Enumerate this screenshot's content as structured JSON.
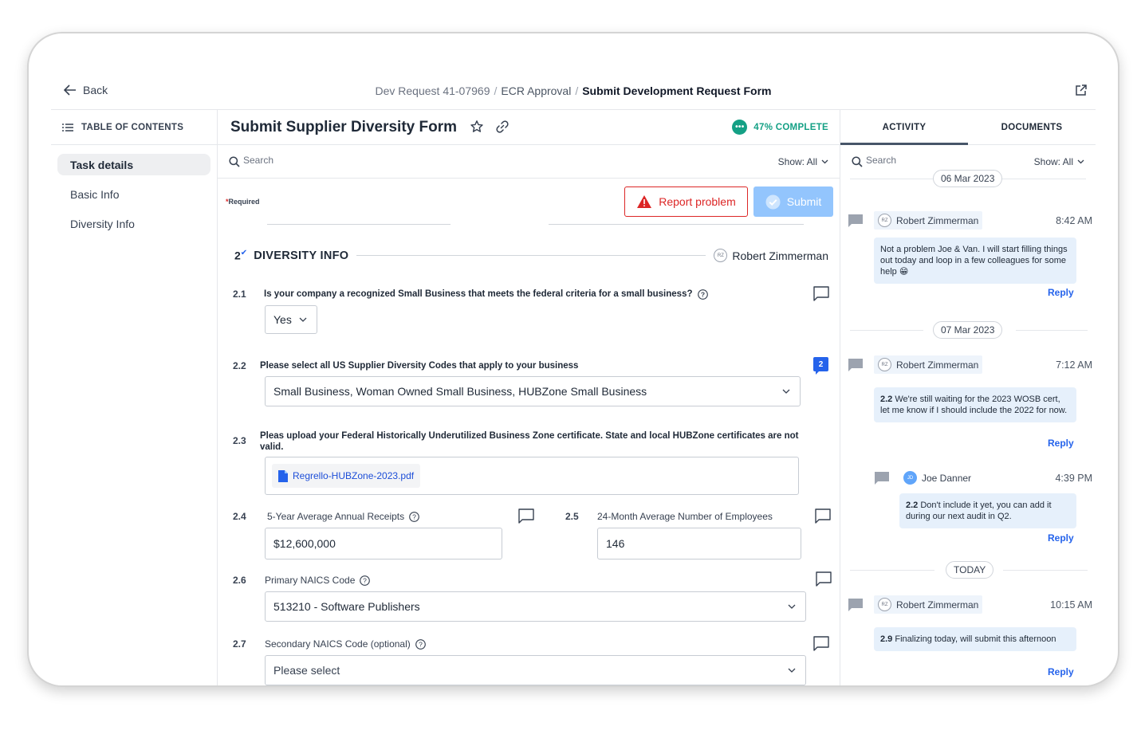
{
  "header": {
    "back_label": "Back",
    "crumb_1": "Dev Request 41-07969",
    "crumb_2": "ECR Approval",
    "crumb_3": "Submit Development Request Form",
    "separator": "/"
  },
  "toc": {
    "title": "TABLE OF CONTENTS",
    "items": [
      {
        "label": "Task details"
      },
      {
        "label": "Basic Info"
      },
      {
        "label": "Diversity Info"
      }
    ]
  },
  "form": {
    "title": "Submit Supplier Diversity Form",
    "complete_label": "47% COMPLETE",
    "complete_percent": 47,
    "search_placeholder": "Search",
    "show_label": "Show: All",
    "required_label": "Required",
    "report_label": "Report problem",
    "submit_label": "Submit",
    "accent": "#2563eb",
    "success": "#14a085",
    "danger": "#dc2626"
  },
  "section": {
    "number": "2",
    "title": "DIVERSITY INFO",
    "owner_initials": "RZ",
    "owner_name": "Robert Zimmerman"
  },
  "questions": {
    "q21": {
      "num": "2.1",
      "label": "Is your company a recognized Small Business that meets the federal criteria for a small business?",
      "value": "Yes"
    },
    "q22": {
      "num": "2.2",
      "label": "Please select all US Supplier Diversity Codes that apply to your business",
      "value": "Small Business, Woman Owned Small Business, HUBZone Small Business",
      "comment_count": "2"
    },
    "q23": {
      "num": "2.3",
      "label": "Pleas upload your Federal Historically Underutilized Business Zone certificate. State and local HUBZone certificates are not valid.",
      "file": "Regrello-HUBZone-2023.pdf"
    },
    "q24": {
      "num": "2.4",
      "label": "5-Year Average Annual Receipts",
      "value": "$12,600,000"
    },
    "q25": {
      "num": "2.5",
      "label": "24-Month Average Number of Employees",
      "value": "146"
    },
    "q26": {
      "num": "2.6",
      "label": "Primary NAICS Code",
      "value": "513210 - Software Publishers"
    },
    "q27": {
      "num": "2.7",
      "label": "Secondary NAICS Code (optional)",
      "value": "Please select"
    }
  },
  "activity": {
    "tab_activity": "ACTIVITY",
    "tab_documents": "DOCUMENTS",
    "search_placeholder": "Search",
    "show_label": "Show: All",
    "reply_label": "Reply",
    "dates": [
      "06 Mar 2023",
      "07 Mar 2023",
      "TODAY"
    ],
    "comments": [
      {
        "initials": "RZ",
        "author": "Robert Zimmerman",
        "time": "8:42 AM",
        "ref": "",
        "text": "Not a problem Joe & Van. I will start filling things out today and loop in a few colleagues for some help 😁"
      },
      {
        "initials": "RZ",
        "author": "Robert Zimmerman",
        "time": "7:12 AM",
        "ref": "2.2",
        "text": " We're still waiting for the 2023 WOSB cert, let me know if I should include the 2022 for now."
      },
      {
        "initials": "JD",
        "author": "Joe Danner",
        "time": "4:39 PM",
        "ref": "2.2",
        "text": " Don't include it yet, you can add it during our next audit in Q2."
      },
      {
        "initials": "RZ",
        "author": "Robert Zimmerman",
        "time": "10:15 AM",
        "ref": "2.9",
        "text": " Finalizing today, will submit this afternoon"
      }
    ]
  }
}
